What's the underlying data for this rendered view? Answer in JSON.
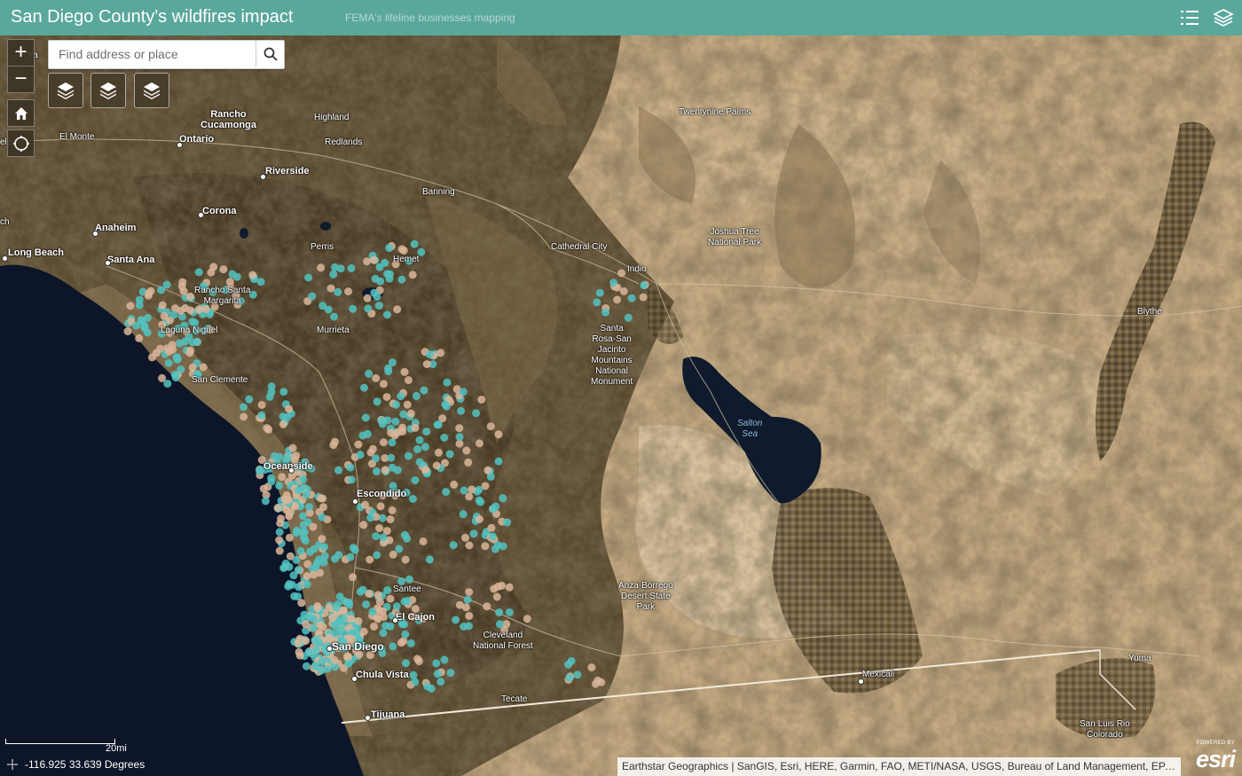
{
  "header": {
    "title": "San Diego County's wildfires impact",
    "subtitle": "FEMA's lifeline businesses mapping",
    "legend_icon": "legend-list-icon",
    "layers_icon": "layer-list-icon"
  },
  "search": {
    "placeholder": "Find address or place",
    "button_icon": "search-icon"
  },
  "controls": {
    "zoom_in": "+",
    "zoom_out": "−",
    "home_icon": "home-icon",
    "locate_icon": "locate-icon",
    "layer_buttons": [
      "layers-icon",
      "layers-icon",
      "layers-icon"
    ]
  },
  "scale": {
    "label": "20mi"
  },
  "coordinates": {
    "text": "-116.925 33.639 Degrees"
  },
  "attribution": {
    "text": "Earthstar Geographics | SanGIS, Esri, HERE, Garmin, FAO, METI/NASA, USGS, Bureau of Land Management, EPA, NPS"
  },
  "esri": {
    "powered": "POWERED BY",
    "logo": "esri"
  },
  "colors": {
    "header": "#5aa89b",
    "point_teal": "#54c2c0",
    "point_tan": "#d9b59a",
    "ocean": "#0d1628",
    "terrain_dark": "#4a3e28",
    "desert": "#c7ad86"
  },
  "map_labels": [
    {
      "name": "Rancho Cucamonga",
      "text": "Rancho\nCucamonga"
    },
    {
      "name": "Highland",
      "text": "Highland"
    },
    {
      "name": "El Monte",
      "text": "El Monte"
    },
    {
      "name": "Ontario",
      "text": "Ontario"
    },
    {
      "name": "Redlands",
      "text": "Redlands"
    },
    {
      "name": "Twentynine Palms",
      "text": "Twentynine Palms"
    },
    {
      "name": "Riverside",
      "text": "Riverside"
    },
    {
      "name": "Banning",
      "text": "Banning"
    },
    {
      "name": "Corona",
      "text": "Corona"
    },
    {
      "name": "Anaheim",
      "text": "Anaheim"
    },
    {
      "name": "Joshua Tree National Park",
      "text": "Joshua Tree\nNational Park"
    },
    {
      "name": "Cathedral City",
      "text": "Cathedral City"
    },
    {
      "name": "Perris",
      "text": "Perris"
    },
    {
      "name": "Long Beach",
      "text": "Long Beach"
    },
    {
      "name": "Santa Ana",
      "text": "Santa Ana"
    },
    {
      "name": "Hemet",
      "text": "Hemet"
    },
    {
      "name": "Indio",
      "text": "Indio"
    },
    {
      "name": "Rancho Santa Margarita",
      "text": "Rancho Santa\nMargarita"
    },
    {
      "name": "Blythe",
      "text": "Blythe"
    },
    {
      "name": "Santa Rosa-San Jacinto Mountains National Monument",
      "text": "Santa\nRosa-San\nJacinto\nMountains\nNational\nMonument"
    },
    {
      "name": "Laguna Niguel",
      "text": "Laguna Niguel"
    },
    {
      "name": "Murrieta",
      "text": "Murrieta"
    },
    {
      "name": "San Clemente",
      "text": "San Clemente"
    },
    {
      "name": "Salton Sea",
      "text": "Salton\nSea"
    },
    {
      "name": "Oceanside",
      "text": "Oceanside"
    },
    {
      "name": "Escondido",
      "text": "Escondido"
    },
    {
      "name": "Anza-Borrego Desert State Park",
      "text": "Anza-Borrego\nDesert State\nPark"
    },
    {
      "name": "Santee",
      "text": "Santee"
    },
    {
      "name": "El Cajon",
      "text": "El Cajon"
    },
    {
      "name": "Cleveland National Forest",
      "text": "Cleveland\nNational Forest"
    },
    {
      "name": "San Diego",
      "text": "San Diego"
    },
    {
      "name": "Yuma",
      "text": "Yuma"
    },
    {
      "name": "Chula Vista",
      "text": "Chula Vista"
    },
    {
      "name": "Mexicali",
      "text": "Mexicali"
    },
    {
      "name": "Tecate",
      "text": "Tecate"
    },
    {
      "name": "Tijuana",
      "text": "Tijuana"
    },
    {
      "name": "San Luis Rio Colorado",
      "text": "San Luis Rio\nColorado"
    },
    {
      "name": "Na",
      "text": "Na"
    },
    {
      "name": "eles",
      "text": "eles"
    },
    {
      "name": "ch",
      "text": "ch"
    }
  ]
}
